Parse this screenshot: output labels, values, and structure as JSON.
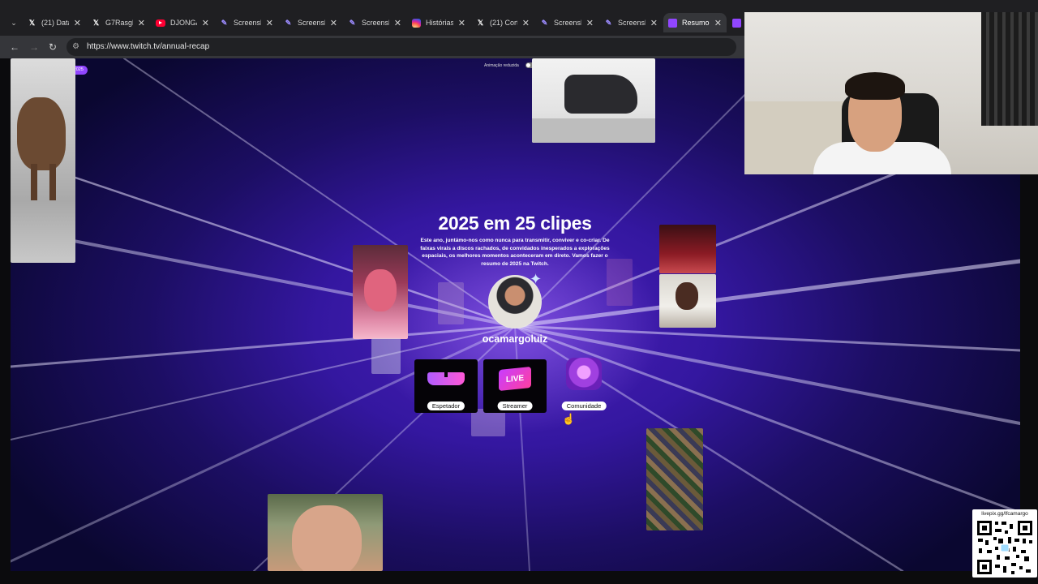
{
  "browser": {
    "tabs": [
      {
        "title": "(21) Data",
        "favicon": "x-logo-icon",
        "active": false
      },
      {
        "title": "G7Rasgh",
        "favicon": "x-logo-icon",
        "active": false
      },
      {
        "title": "DJONGA",
        "favicon": "youtube-icon",
        "active": false
      },
      {
        "title": "Screensh",
        "favicon": "feather-icon",
        "active": false
      },
      {
        "title": "Screensh",
        "favicon": "feather-icon",
        "active": false
      },
      {
        "title": "Screensh",
        "favicon": "feather-icon",
        "active": false
      },
      {
        "title": "Histórias",
        "favicon": "instagram-icon",
        "active": false
      },
      {
        "title": "(21) Cort",
        "favicon": "x-logo-icon",
        "active": false
      },
      {
        "title": "Screensh",
        "favicon": "feather-icon",
        "active": false
      },
      {
        "title": "Screensh",
        "favicon": "feather-icon",
        "active": false
      },
      {
        "title": "Resumo",
        "favicon": "twitch-icon",
        "active": true
      }
    ],
    "url": "https://www.twitch.tv/annual-recap"
  },
  "page": {
    "logo": "twitch",
    "badge": "Resumo de 2025",
    "animation_toggle_label": "Animação reduzida",
    "title": "2025 em 25 clipes",
    "description": "Este ano, juntámo-nos como nunca para transmitir, conviver e co-criar. De faixas virais a discos rachados, de convidados inesperados a explorações espaciais, os melhores momentos aconteceram em direto. Vamos fazer o resumo de 2025 na Twitch.",
    "username": "ocamargoluiz",
    "cards": [
      {
        "label": "Espetador",
        "icon": "sunglasses-icon"
      },
      {
        "label": "Streamer",
        "icon": "live-icon"
      },
      {
        "label": "Comunidade",
        "icon": "heart-crystal-icon"
      }
    ],
    "streamer_badge_text": "LIVE"
  },
  "overlay": {
    "qr_label": "livepix.gg/lfcamargo"
  },
  "colors": {
    "twitch_purple": "#9146ff",
    "background_deep": "#1c0e63",
    "tab_bar": "#1f1f22"
  }
}
